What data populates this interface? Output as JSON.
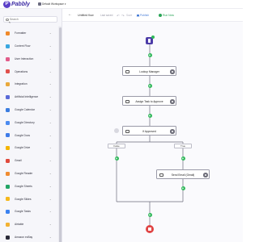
{
  "app": {
    "logo_letter": "P",
    "logo_text": "Pabbly"
  },
  "workspace": {
    "name": "Default Workspace"
  },
  "sidebar": {
    "search_placeholder": "Search",
    "items": [
      {
        "label": "Formatter",
        "color": "#f08a2b",
        "icon": "formatter-icon"
      },
      {
        "label": "Content Flow",
        "color": "#3aa7e0",
        "icon": "flow-icon"
      },
      {
        "label": "User Interaction",
        "color": "#e25c8a",
        "icon": "user-icon"
      },
      {
        "label": "Operations",
        "color": "#e0504c",
        "icon": "operations-icon"
      },
      {
        "label": "Integration",
        "color": "#e9a93c",
        "icon": "integration-icon"
      },
      {
        "label": "Artificial Intelligence",
        "color": "#5a6ad8",
        "icon": "ai-icon"
      },
      {
        "label": "Google Calendar",
        "color": "#3b7de0",
        "icon": "google-calendar-icon"
      },
      {
        "label": "Google Directory",
        "color": "#4c8bf0",
        "icon": "google-directory-icon"
      },
      {
        "label": "Google Docs",
        "color": "#3f7ce8",
        "icon": "google-docs-icon"
      },
      {
        "label": "Google Drive",
        "color": "#f4b400",
        "icon": "google-drive-icon"
      },
      {
        "label": "Gmail",
        "color": "#e04a3c",
        "icon": "gmail-icon"
      },
      {
        "label": "Google Reader",
        "color": "#f08c32",
        "icon": "google-reader-icon"
      },
      {
        "label": "Google Sheets",
        "color": "#23a566",
        "icon": "google-sheets-icon"
      },
      {
        "label": "Google Slides",
        "color": "#f5b81c",
        "icon": "google-slides-icon"
      },
      {
        "label": "Google Tasks",
        "color": "#3b82f0",
        "icon": "google-tasks-icon"
      },
      {
        "label": "Airtable",
        "color": "#f2b233",
        "icon": "airtable-icon"
      },
      {
        "label": "Amazon ecBay",
        "color": "#2a2a38",
        "icon": "amazon-icon"
      }
    ]
  },
  "header": {
    "title": "Untitled flow",
    "status": "Last saved",
    "save_label": "Save",
    "publish_label": "Publish",
    "run_label": "Run Now"
  },
  "flow": {
    "nodes": {
      "lookup": "Lookup Manager",
      "assign": "Assign Task to Approve",
      "condition": "If Approved",
      "send_email": "Send Email (Gmail)"
    },
    "branches": {
      "false_label": "False",
      "true_label": "True"
    }
  }
}
